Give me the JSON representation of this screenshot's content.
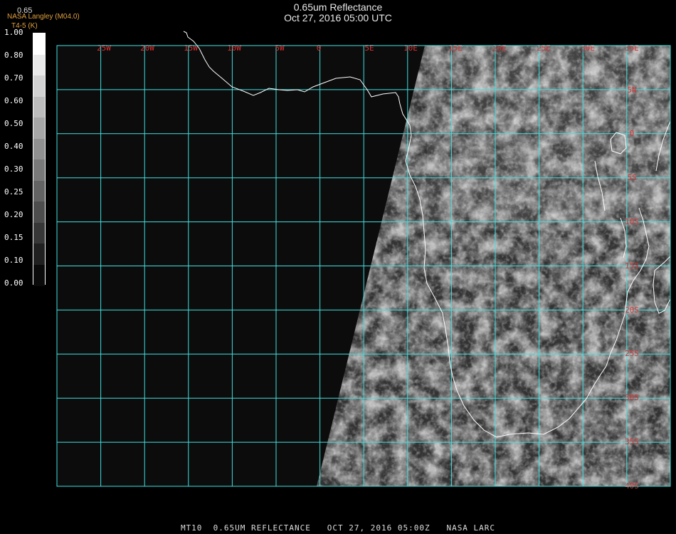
{
  "header": {
    "title": "0.65um Reflectance",
    "timestamp": "Oct 27, 2016 05:00 UTC",
    "credit_line1": "NASA Langley (M04.0)",
    "credit_line2": "T4-5 (K)",
    "band_label": "0.65"
  },
  "colorbar": {
    "labels": [
      "1.00",
      "0.80",
      "0.70",
      "0.60",
      "0.50",
      "0.40",
      "0.30",
      "0.25",
      "0.20",
      "0.15",
      "0.10",
      "0.00"
    ]
  },
  "map": {
    "lon_labels": [
      "25W",
      "20W",
      "15W",
      "10W",
      "5W",
      "0",
      "5E",
      "10E",
      "15E",
      "20E",
      "25E",
      "30E",
      "35E"
    ],
    "lat_labels": [
      "5N",
      "0",
      "5S",
      "10S",
      "15S",
      "20S",
      "25S",
      "30S",
      "35S",
      "40S"
    ],
    "grid_color": "#40e0e0",
    "label_color": "#e03030",
    "coast_color": "#ffffff"
  },
  "footer": {
    "text": "MT10  0.65UM REFLECTANCE   OCT 27, 2016 05:00Z   NASA LARC"
  }
}
